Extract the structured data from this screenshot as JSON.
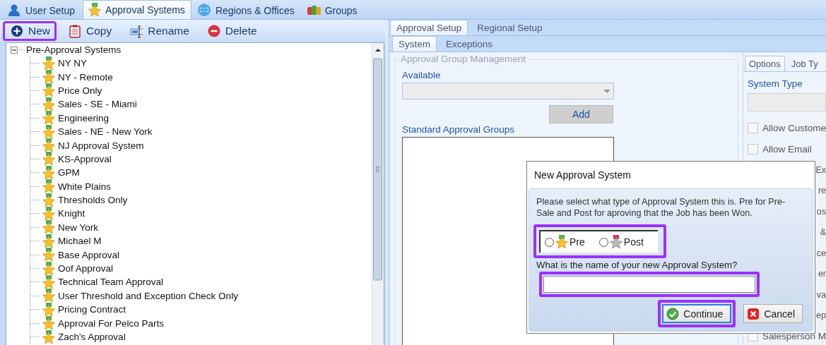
{
  "top_tabs": [
    {
      "label": "User Setup",
      "selected": false
    },
    {
      "label": "Approval Systems",
      "selected": true
    },
    {
      "label": "Regions & Offices",
      "selected": false
    },
    {
      "label": "Groups",
      "selected": false
    }
  ],
  "toolbar": [
    {
      "label": "New",
      "kind": "new",
      "highlighted": true
    },
    {
      "label": "Copy",
      "kind": "copy",
      "highlighted": false
    },
    {
      "label": "Rename",
      "kind": "rename",
      "highlighted": false
    },
    {
      "label": "Delete",
      "kind": "delete",
      "highlighted": false
    }
  ],
  "tree": {
    "label": "Pre-Approval Systems",
    "expanded": true,
    "children": [
      {
        "label": "NY NY"
      },
      {
        "label": "NY - Remote"
      },
      {
        "label": "Price Only"
      },
      {
        "label": "Sales - SE - Miami"
      },
      {
        "label": "Engineering"
      },
      {
        "label": "Sales - NE - New York"
      },
      {
        "label": "NJ Approval System"
      },
      {
        "label": "KS-Approval"
      },
      {
        "label": "GPM"
      },
      {
        "label": "White Plains"
      },
      {
        "label": "Thresholds Only"
      },
      {
        "label": "Knight"
      },
      {
        "label": "New York"
      },
      {
        "label": "Michael M"
      },
      {
        "label": "Base Approval"
      },
      {
        "label": "Oof Approval"
      },
      {
        "label": "Technical Team Approval"
      },
      {
        "label": "User Threshold and Exception Check Only"
      },
      {
        "label": "Pricing Contract"
      },
      {
        "label": "Approval For Pelco Parts"
      },
      {
        "label": "Zach's Approval"
      }
    ]
  },
  "setup_tabs": [
    {
      "label": "Approval Setup",
      "selected": true
    },
    {
      "label": "Regional Setup",
      "selected": false
    }
  ],
  "system_tabs": [
    {
      "label": "System",
      "selected": true
    },
    {
      "label": "Exceptions",
      "selected": false
    }
  ],
  "group_box": {
    "title": "Approval Group Management",
    "available_label": "Available",
    "add_button": "Add",
    "standard_label": "Standard Approval Groups"
  },
  "options_panel": {
    "tabs": [
      {
        "label": "Options",
        "selected": true
      },
      {
        "label": "Job Ty",
        "selected": false
      }
    ],
    "system_type_label": "System Type",
    "items": [
      {
        "label": "Allow Custome",
        "kind": "checkbox",
        "checked": false
      },
      {
        "label": "Allow Email",
        "kind": "checkbox",
        "checked": false
      },
      {
        "label": "Ex",
        "kind": "fragment"
      },
      {
        "label": "re",
        "kind": "fragment"
      },
      {
        "label": "os",
        "kind": "fragment"
      },
      {
        "label": "&",
        "kind": "fragment"
      },
      {
        "label": "ce",
        "kind": "fragment"
      },
      {
        "label": "er",
        "kind": "fragment"
      },
      {
        "label": "va",
        "kind": "fragment"
      },
      {
        "label": "ep",
        "kind": "fragment"
      },
      {
        "label": "Salesperson M",
        "kind": "checkbox",
        "checked": false
      }
    ]
  },
  "dialog": {
    "title": "New Approval System",
    "message": "Please select what type of Approval System this is. Pre for Pre-Sale and Post for aproving that the Job has been Won.",
    "type_highlighted": true,
    "type_options": [
      {
        "label": "Pre",
        "kind": "pre",
        "selected": false
      },
      {
        "label": "Post",
        "kind": "post",
        "selected": false
      }
    ],
    "name_label": "What is the name of your new Approval System?",
    "name_highlighted": true,
    "buttons": [
      {
        "label": "Continue",
        "kind": "continue",
        "highlighted": true
      },
      {
        "label": "Cancel",
        "kind": "cancel",
        "highlighted": false
      }
    ]
  }
}
